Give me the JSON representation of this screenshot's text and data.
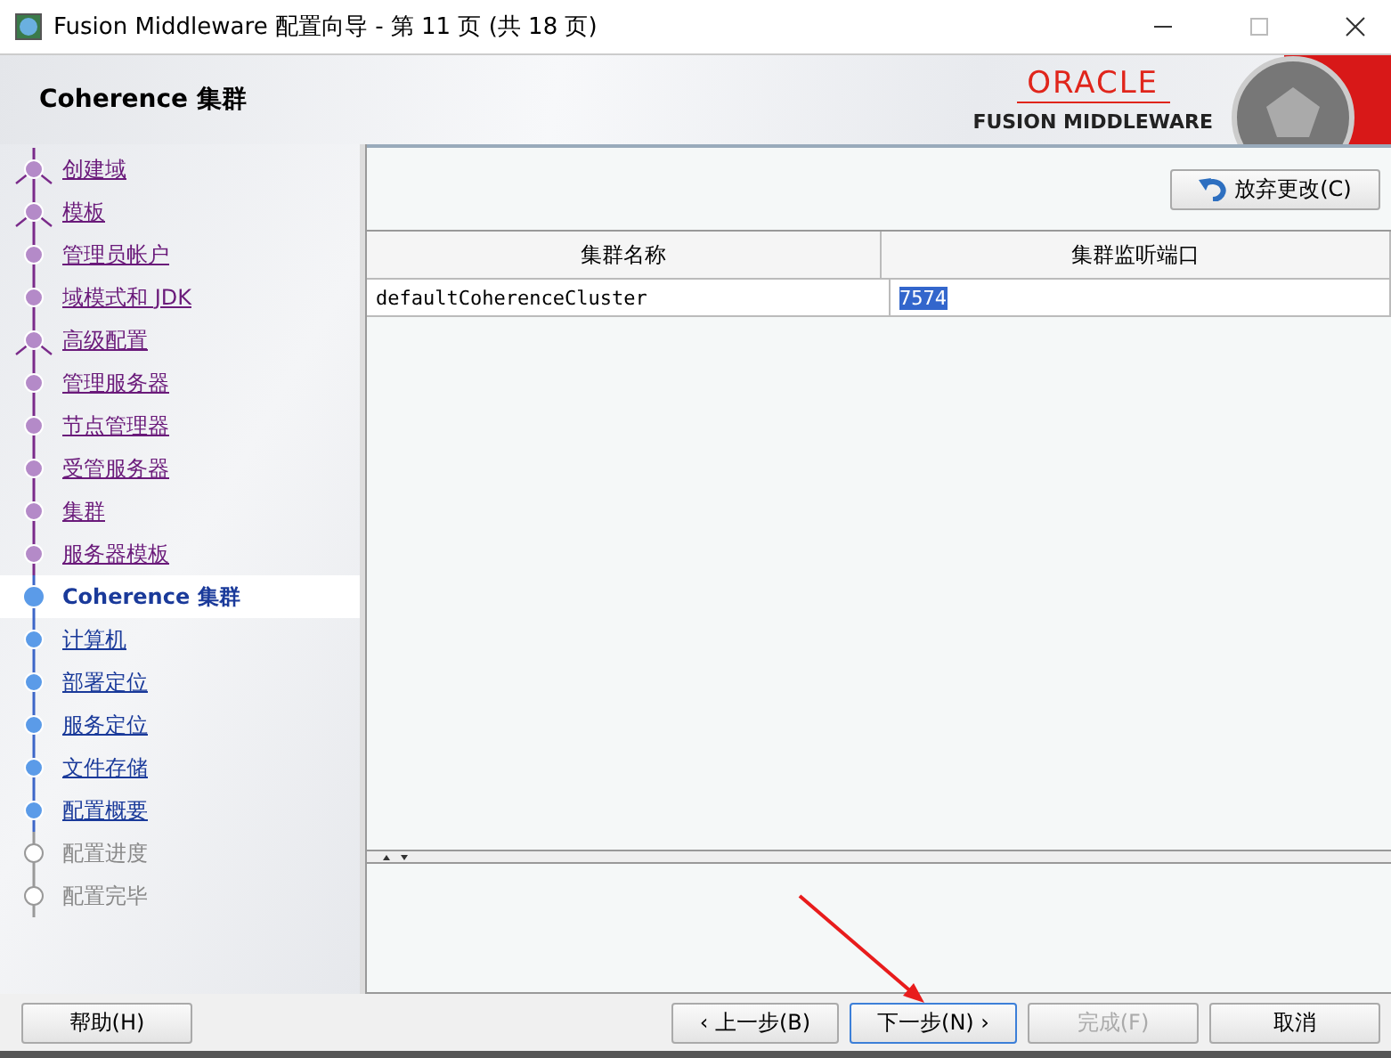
{
  "window": {
    "title": "Fusion Middleware 配置向导 - 第 11 页 (共 18 页)"
  },
  "header": {
    "title": "Coherence 集群",
    "logo_top": "ORACLE",
    "logo_bottom": "FUSION MIDDLEWARE"
  },
  "steps": [
    {
      "label": "创建域",
      "visited": true,
      "selected": false,
      "disabled": false,
      "branch": true
    },
    {
      "label": "模板",
      "visited": true,
      "selected": false,
      "disabled": false,
      "branch": true
    },
    {
      "label": "管理员帐户",
      "visited": true,
      "selected": false,
      "disabled": false,
      "branch": false
    },
    {
      "label": "域模式和 JDK",
      "visited": true,
      "selected": false,
      "disabled": false,
      "branch": false
    },
    {
      "label": "高级配置",
      "visited": true,
      "selected": false,
      "disabled": false,
      "branch": true
    },
    {
      "label": "管理服务器",
      "visited": true,
      "selected": false,
      "disabled": false,
      "branch": false
    },
    {
      "label": "节点管理器",
      "visited": true,
      "selected": false,
      "disabled": false,
      "branch": false
    },
    {
      "label": "受管服务器",
      "visited": true,
      "selected": false,
      "disabled": false,
      "branch": false
    },
    {
      "label": "集群",
      "visited": true,
      "selected": false,
      "disabled": false,
      "branch": false
    },
    {
      "label": "服务器模板",
      "visited": true,
      "selected": false,
      "disabled": false,
      "branch": false
    },
    {
      "label": "Coherence 集群",
      "visited": false,
      "selected": true,
      "disabled": false,
      "branch": false
    },
    {
      "label": "计算机",
      "visited": false,
      "selected": false,
      "disabled": false,
      "branch": false
    },
    {
      "label": "部署定位",
      "visited": false,
      "selected": false,
      "disabled": false,
      "branch": false
    },
    {
      "label": "服务定位",
      "visited": false,
      "selected": false,
      "disabled": false,
      "branch": false
    },
    {
      "label": "文件存储",
      "visited": false,
      "selected": false,
      "disabled": false,
      "branch": false
    },
    {
      "label": "配置概要",
      "visited": false,
      "selected": false,
      "disabled": false,
      "branch": false
    },
    {
      "label": "配置进度",
      "visited": false,
      "selected": false,
      "disabled": true,
      "branch": false
    },
    {
      "label": "配置完毕",
      "visited": false,
      "selected": false,
      "disabled": true,
      "branch": false
    }
  ],
  "discard_button": {
    "label": "放弃更改(C)"
  },
  "table": {
    "columns": [
      "集群名称",
      "集群监听端口"
    ],
    "rows": [
      {
        "cells": [
          {
            "text": "defaultCoherenceCluster",
            "selected": false
          },
          {
            "text": "7574",
            "selected": true
          }
        ]
      }
    ]
  },
  "buttons": [
    {
      "label": "帮助(H)",
      "disabled": false,
      "focused": false
    },
    {
      "label": "‹ 上一步(B)",
      "disabled": false,
      "focused": false
    },
    {
      "label": "下一步(N) ›",
      "disabled": false,
      "focused": true
    },
    {
      "label": "完成(F)",
      "disabled": true,
      "focused": false
    },
    {
      "label": "取消",
      "disabled": false,
      "focused": false
    }
  ]
}
